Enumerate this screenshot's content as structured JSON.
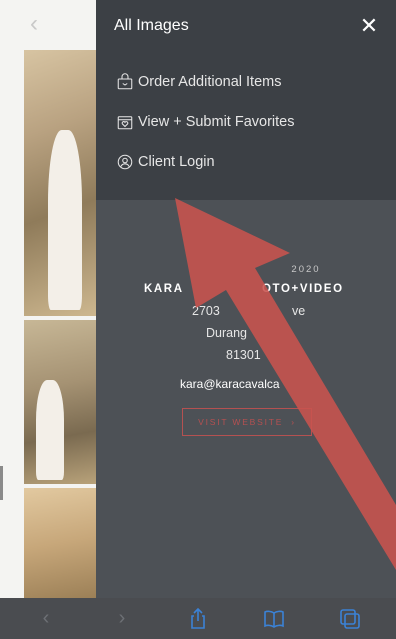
{
  "drawer": {
    "title": "All Images",
    "close_icon": "close-icon",
    "menu": [
      {
        "label": "Order Additional Items",
        "icon": "shopping-bag-icon"
      },
      {
        "label": "View + Submit Favorites",
        "icon": "heart-box-icon"
      },
      {
        "label": "Client Login",
        "icon": "user-circle-icon"
      }
    ]
  },
  "studio": {
    "copyright_visible": "2020",
    "name_left": "KARA",
    "name_right": "OTO+VIDEO",
    "address_line1": "2703",
    "address_line1_end": "ve",
    "address_line2": "Durang",
    "address_line3": "81301",
    "email": "kara@karacavalca",
    "visit_button": "VISIT WEBSITE"
  },
  "toolbar": {
    "back_icon": "chevron-left-icon",
    "forward_icon": "chevron-right-icon",
    "share_icon": "share-icon",
    "bookmarks_icon": "book-icon",
    "tabs_icon": "tabs-icon"
  },
  "colors": {
    "drawer_bg": "#4d5156",
    "drawer_header_bg": "#3c4045",
    "accent_red": "#c9534f",
    "toolbar_blue": "#3b82d6"
  }
}
